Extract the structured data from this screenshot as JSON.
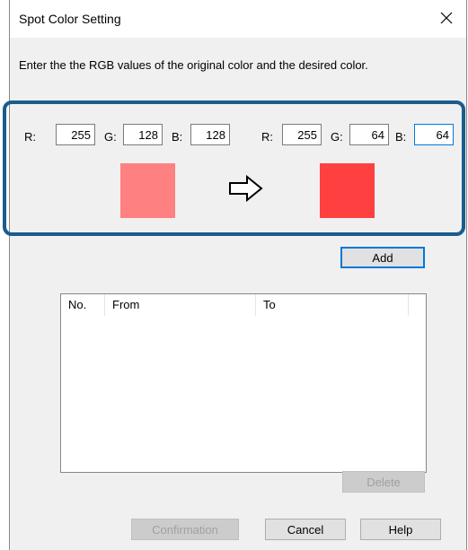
{
  "dialog": {
    "title": "Spot Color Setting",
    "close_icon": "close-icon"
  },
  "instruction": "Enter the the RGB values of the original color and the desired color.",
  "labels": {
    "r": "R:",
    "g": "G:",
    "b": "B:"
  },
  "original": {
    "r": "255",
    "g": "128",
    "b": "128",
    "swatch_color": "#ff8080"
  },
  "desired": {
    "r": "255",
    "g": "64",
    "b": "64",
    "swatch_color": "#ff4040"
  },
  "arrow_icon": "right-arrow-icon",
  "highlight_color": "#1a5c8e",
  "buttons": {
    "add": "Add",
    "delete": "Delete",
    "confirmation": "Confirmation",
    "cancel": "Cancel",
    "help": "Help"
  },
  "list": {
    "columns": [
      "No.",
      "From",
      "To"
    ],
    "rows": []
  }
}
